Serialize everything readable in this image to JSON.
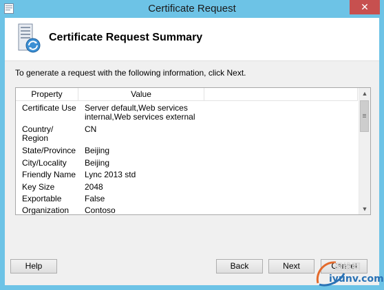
{
  "window": {
    "title": "Certificate Request",
    "close_glyph": "✕"
  },
  "header": {
    "title": "Certificate Request Summary",
    "icon": "certificate-server-icon"
  },
  "instruction": "To generate a request with the following information, click Next.",
  "table": {
    "columns": [
      "Property",
      "Value",
      ""
    ],
    "rows": [
      {
        "property": "Certificate Use",
        "value": "Server default,Web services internal,Web services external"
      },
      {
        "property": "Country/ Region",
        "value": "CN"
      },
      {
        "property": "State/Province",
        "value": "Beijing"
      },
      {
        "property": "City/Locality",
        "value": "Beijing"
      },
      {
        "property": "Friendly Name",
        "value": "Lync 2013 std"
      },
      {
        "property": "Key Size",
        "value": "2048"
      },
      {
        "property": "Exportable",
        "value": "False"
      },
      {
        "property": "Organization",
        "value": "Contoso"
      }
    ]
  },
  "buttons": {
    "help": "Help",
    "back": "Back",
    "next": "Next",
    "cancel": "Cancel"
  },
  "watermark": {
    "top": "运维网",
    "bottom": "iyunv.com"
  },
  "colors": {
    "frame": "#6dc3e6",
    "close": "#c7504f",
    "client": "#f0f0f0"
  }
}
